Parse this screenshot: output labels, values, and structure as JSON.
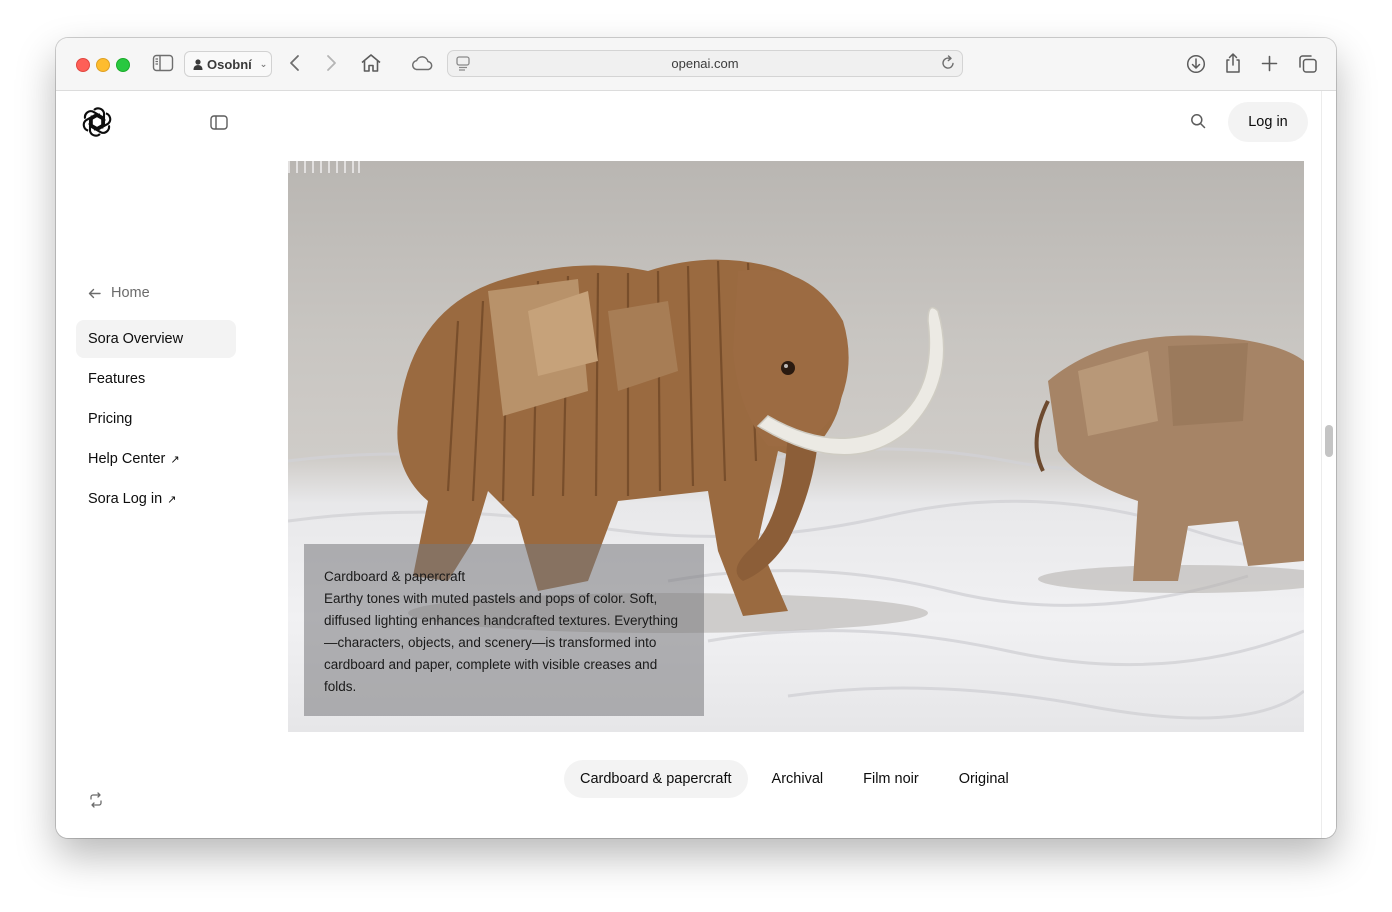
{
  "browser": {
    "profile_label": "Osobní",
    "url": "openai.com"
  },
  "header": {
    "login_label": "Log in"
  },
  "sidebar": {
    "home_label": "Home",
    "items": [
      {
        "label": "Sora Overview",
        "active": true,
        "external": false
      },
      {
        "label": "Features",
        "active": false,
        "external": false
      },
      {
        "label": "Pricing",
        "active": false,
        "external": false
      },
      {
        "label": "Help Center",
        "active": false,
        "external": true
      },
      {
        "label": "Sora Log in",
        "active": false,
        "external": true
      }
    ],
    "external_arrow": "↗"
  },
  "hero": {
    "caption_title": "Cardboard & papercraft",
    "caption_text": "Earthy tones with muted pastels and pops of color. Soft, diffused lighting enhances handcrafted textures. Everything—characters, objects, and scenery—is transformed into cardboard and paper, complete with visible creases and folds."
  },
  "style_tabs": [
    {
      "label": "Cardboard & papercraft",
      "active": true
    },
    {
      "label": "Archival",
      "active": false
    },
    {
      "label": "Film noir",
      "active": false
    },
    {
      "label": "Original",
      "active": false
    }
  ],
  "icons": [
    "sidebar-icon",
    "person-icon",
    "back-icon",
    "forward-icon",
    "home-icon",
    "cloud-icon",
    "page-icon",
    "reload-icon",
    "download-icon",
    "share-icon",
    "new-tab-icon",
    "tabs-overview-icon",
    "openai-logo-icon",
    "sidebar-toggle-icon",
    "search-icon",
    "arrow-left-icon",
    "refresh-icon"
  ]
}
